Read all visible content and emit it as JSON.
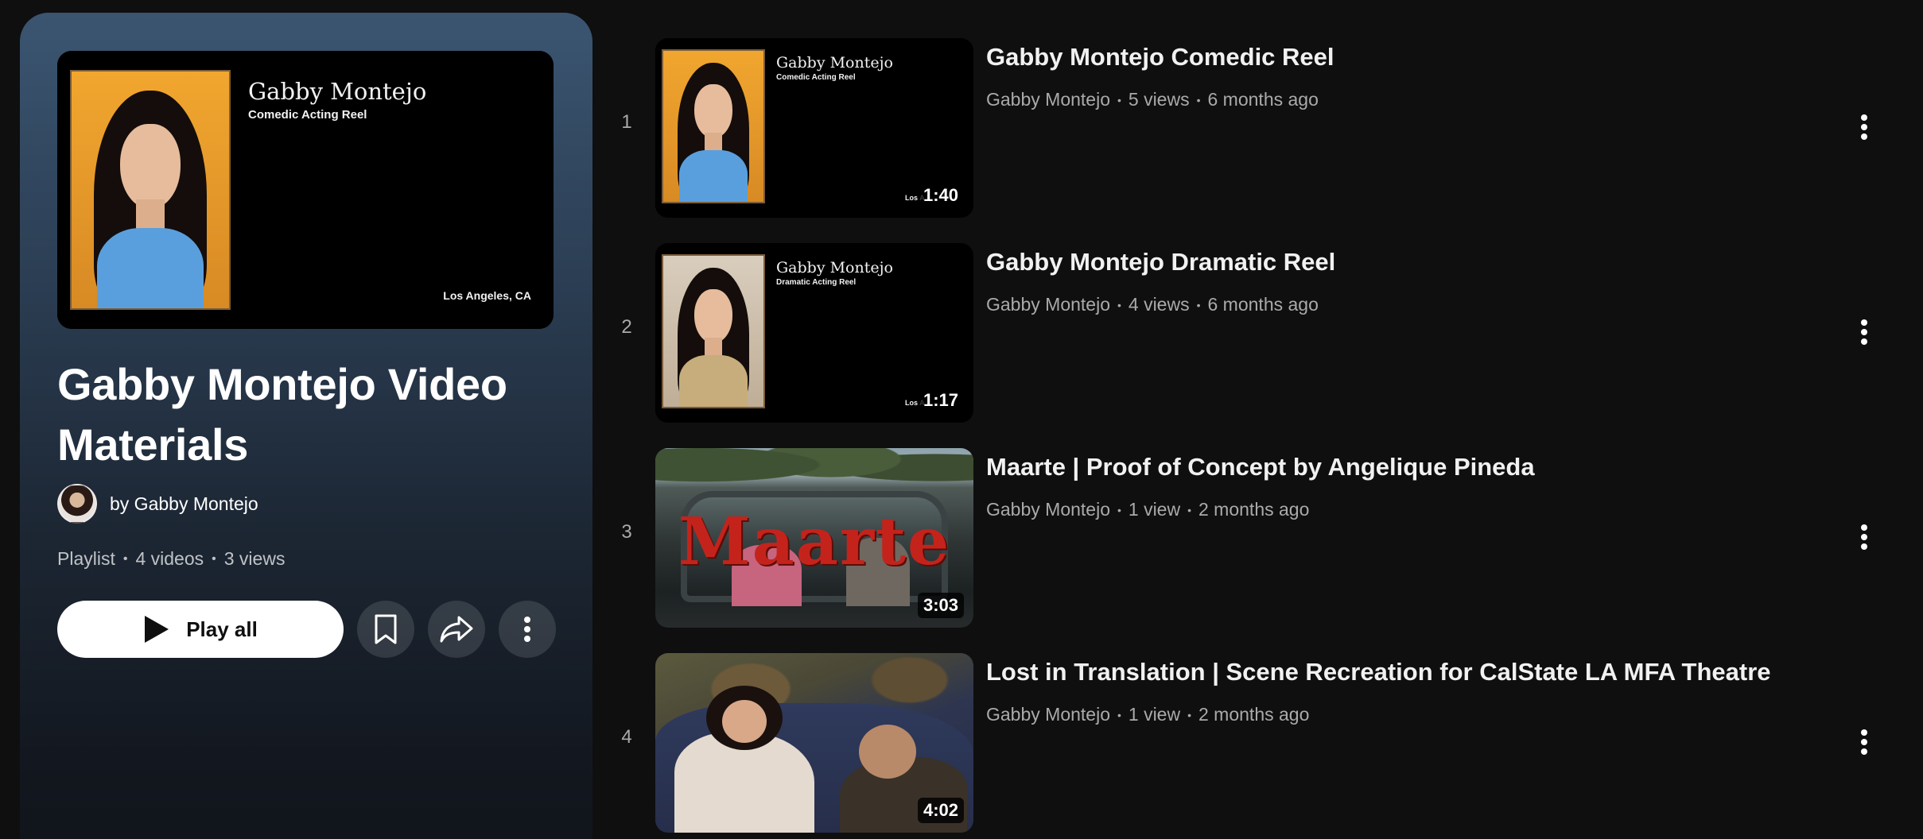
{
  "playlist": {
    "title": "Gabby Montejo Video Materials",
    "owner": "by Gabby Montejo",
    "type_label": "Playlist",
    "video_count": "4 videos",
    "views": "3 views",
    "thumbnail": {
      "name": "Gabby Montejo",
      "subtitle": "Comedic Acting Reel",
      "location": "Los Angeles, CA"
    },
    "actions": {
      "play_all": "Play all",
      "save_icon": "bookmark-icon",
      "share_icon": "share-icon",
      "more_icon": "more-vertical-icon"
    }
  },
  "items": [
    {
      "index": "1",
      "title": "Gabby Montejo Comedic Reel",
      "channel": "Gabby Montejo",
      "views": "5 views",
      "age": "6 months ago",
      "duration": "1:40",
      "thumb_name": "Gabby Montejo",
      "thumb_subtitle": "Comedic Acting Reel",
      "thumb_loc": "Los A"
    },
    {
      "index": "2",
      "title": "Gabby Montejo Dramatic Reel",
      "channel": "Gabby Montejo",
      "views": "4 views",
      "age": "6 months ago",
      "duration": "1:17",
      "thumb_name": "Gabby Montejo",
      "thumb_subtitle": "Dramatic Acting Reel",
      "thumb_loc": "Los A"
    },
    {
      "index": "3",
      "title": "Maarte | Proof of Concept by Angelique Pineda",
      "channel": "Gabby Montejo",
      "views": "1 view",
      "age": "2 months ago",
      "duration": "3:03",
      "thumb_word": "Maarte"
    },
    {
      "index": "4",
      "title": "Lost in Translation | Scene Recreation for CalState LA MFA Theatre",
      "channel": "Gabby Montejo",
      "views": "1 view",
      "age": "2 months ago",
      "duration": "4:02"
    }
  ],
  "colors": {
    "background": "#0f0f0f",
    "panel_top": "#3b5571",
    "text_primary": "#f1f1f1",
    "text_secondary": "#aaaaaa",
    "maarte_red": "#c4231c"
  }
}
